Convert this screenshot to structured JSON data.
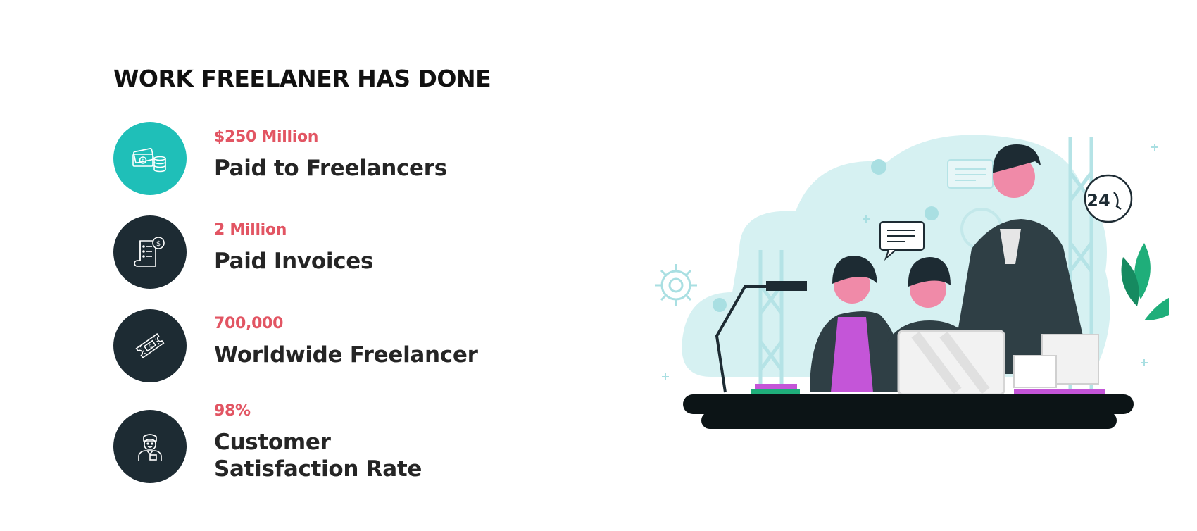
{
  "heading": "WORK FREELANER HAS DONE",
  "stats": [
    {
      "value": "$250 Million",
      "label": "Paid to Freelancers",
      "icon": "money-coins-icon",
      "color": "#1fbfb8"
    },
    {
      "value": "2 Million",
      "label": "Paid Invoices",
      "icon": "invoice-dollar-icon",
      "color": "#1d2b33"
    },
    {
      "value": "700,000",
      "label": "Worldwide Freelancer",
      "icon": "ticket-icon",
      "color": "#1d2b33"
    },
    {
      "value": "98%",
      "label": "Customer\nSatisfaction Rate",
      "icon": "customer-icon",
      "color": "#1d2b33"
    }
  ],
  "illustration": {
    "support_badge": "24",
    "colors": {
      "accent": "#e25563",
      "pink": "#f08aa8",
      "magenta": "#c455d8",
      "teal_light": "#d6f1f2",
      "dark": "#1d2b33"
    }
  }
}
